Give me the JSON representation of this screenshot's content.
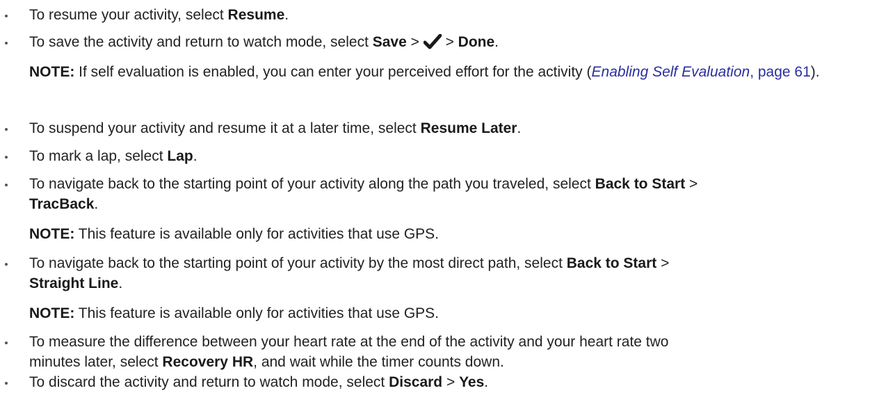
{
  "items": [
    {
      "pre": "To resume your activity, select ",
      "b1": "Resume",
      "post": "."
    },
    {
      "pre": "To save the activity and return to watch mode, select ",
      "b1": "Save",
      "sep1": " > ",
      "icon": "checkmark-icon",
      "sep2": " > ",
      "b2": "Done",
      "post": "."
    },
    {
      "pre": "To suspend your activity and resume it at a later time, select ",
      "b1": "Resume Later",
      "post": "."
    },
    {
      "pre": "To mark a lap, select ",
      "b1": "Lap",
      "post": "."
    },
    {
      "pre": "To navigate back to the starting point of your activity along the path you traveled, select ",
      "b1": "Back to Start",
      "sep1": " >",
      "b2": "TracBack",
      "post": "."
    },
    {
      "pre": "To navigate back to the starting point of your activity by the most direct path, select ",
      "b1": "Back to Start",
      "sep1": " >",
      "b2": "Straight Line",
      "post": "."
    },
    {
      "pre": "To measure the difference between your heart rate at the end of the activity and your heart rate two",
      "pre2": "minutes later, select ",
      "b1": "Recovery HR",
      "post": ", and wait while the timer counts down."
    },
    {
      "pre": "To discard the activity and return to watch mode, select ",
      "b1": "Discard",
      "sep1": " > ",
      "b2": "Yes",
      "post": "."
    }
  ],
  "notes": {
    "label": "NOTE:",
    "self_eval_text": " If self evaluation is enabled, you can enter your perceived effort for the activity (",
    "self_eval_link": "Enabling Self Evaluation",
    "self_eval_page": ", page 61",
    "self_eval_close": ").",
    "gps_text": " This feature is available only for activities that use GPS."
  },
  "colors": {
    "text": "#222222",
    "link": "#2a2e9e"
  }
}
